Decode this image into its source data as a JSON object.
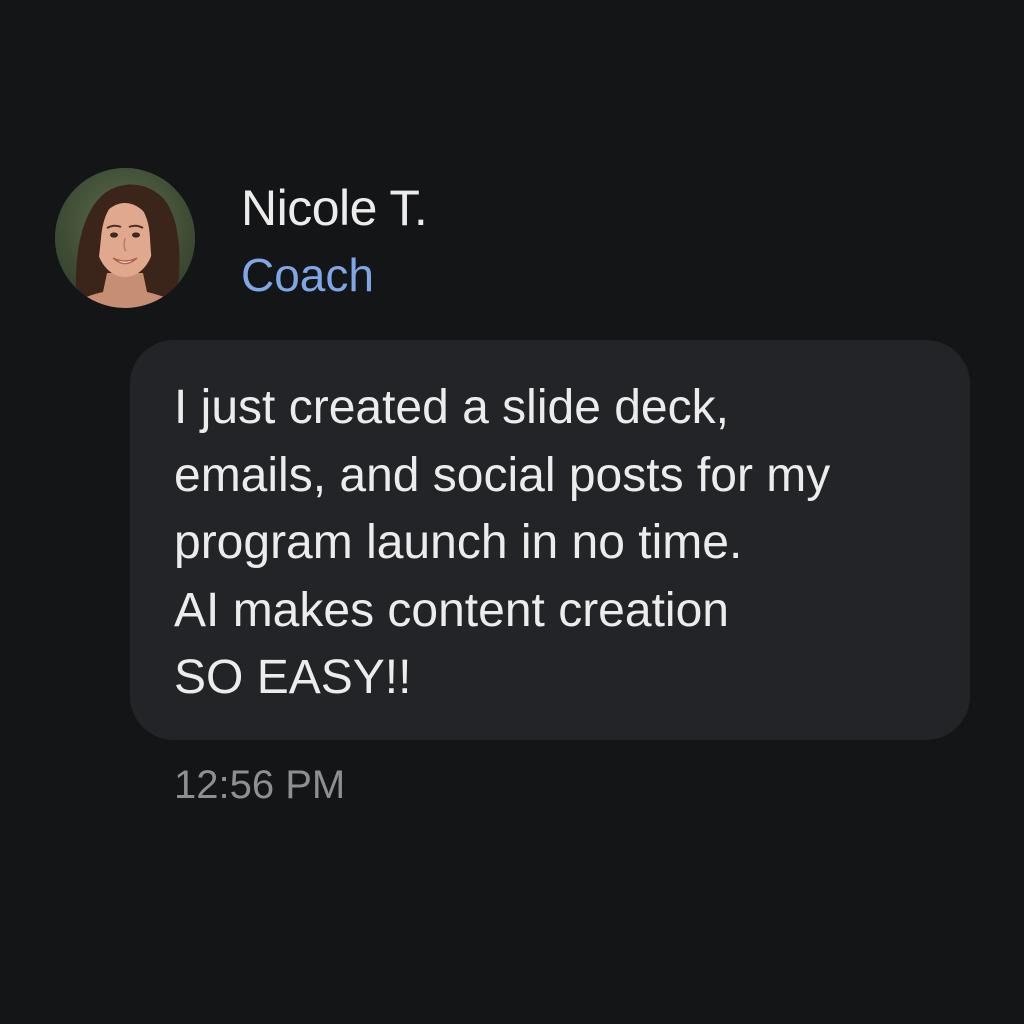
{
  "sender": {
    "name": "Nicole T.",
    "role": "Coach",
    "role_color": "#7fa6e6",
    "avatar_icon": "profile-photo-woman"
  },
  "message": {
    "lines": [
      "I just created a slide deck,",
      "emails, and social posts for my",
      "program launch in no time.",
      "AI makes content creation",
      "SO EASY!!"
    ],
    "timestamp": "12:56 PM"
  },
  "colors": {
    "background": "#141517",
    "bubble": "#232427",
    "text": "#ececec",
    "timestamp": "#8e8f93"
  }
}
